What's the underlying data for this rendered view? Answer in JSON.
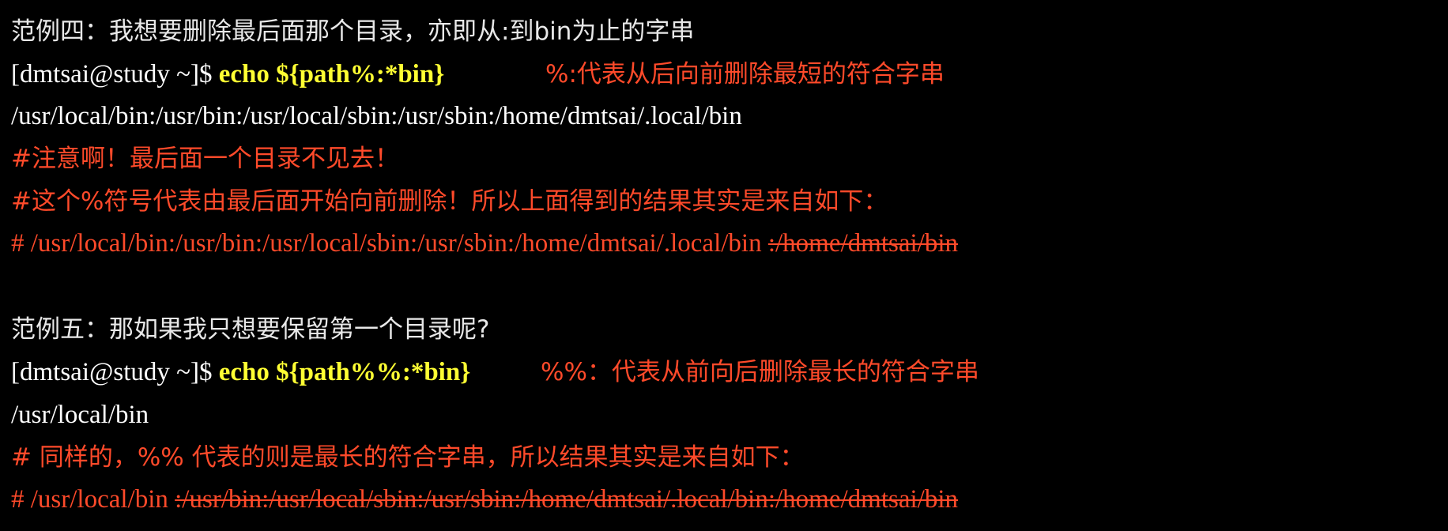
{
  "example4": {
    "heading": "范例四：我想要删除最后面那个目录，亦即从:到bin为止的字串",
    "prompt": "[dmtsai@study ~]$ ",
    "command": "echo ${path%:*bin}",
    "note": "%:代表从后向前删除最短的符合字串",
    "output": "/usr/local/bin:/usr/bin:/usr/local/sbin:/usr/sbin:/home/dmtsai/.local/bin",
    "comment1": "#注意啊！最后面一个目录不见去！",
    "comment2": "#这个%符号代表由最后面开始向前删除！所以上面得到的结果其实是来自如下：",
    "comment3_kept": "# /usr/local/bin:/usr/bin:/usr/local/sbin:/usr/sbin:/home/dmtsai/.local/bin ",
    "comment3_struck": ":/home/dmtsai/bin"
  },
  "example5": {
    "heading": "范例五：那如果我只想要保留第一个目录呢?",
    "prompt": "[dmtsai@study ~]$ ",
    "command": "echo ${path%%:*bin}",
    "note": "%%：代表从前向后删除最长的符合字串",
    "output": "/usr/local/bin",
    "comment1": "# 同样的，%% 代表的则是最长的符合字串，所以结果其实是来自如下：",
    "comment2_kept": "# /usr/local/bin ",
    "comment2_struck": ":/usr/bin:/usr/local/sbin:/usr/sbin:/home/dmtsai/.local/bin:/home/dmtsai/bin"
  },
  "colors": {
    "background": "#000000",
    "command": "#ffff33",
    "annotation": "#ff4a2a",
    "text": "#ffffff"
  }
}
